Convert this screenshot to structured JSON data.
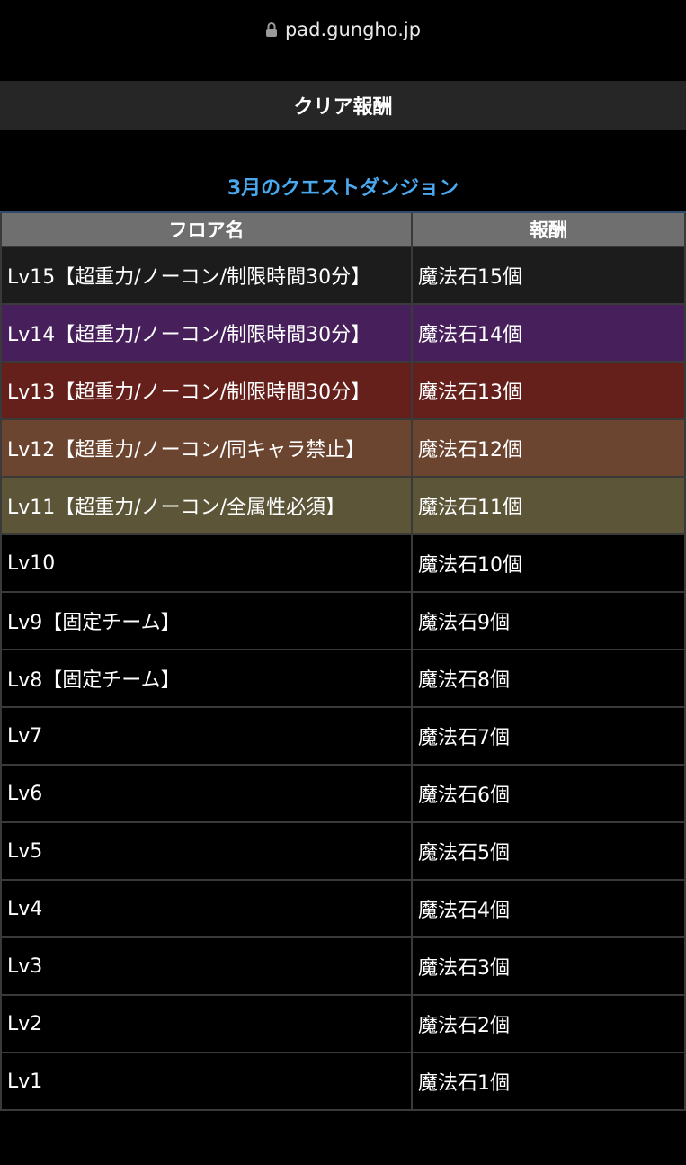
{
  "browser": {
    "url": "pad.gungho.jp",
    "lock_icon": "lock-icon"
  },
  "section": {
    "title": "クリア報酬"
  },
  "subtitle": "3月のクエストダンジョン",
  "table": {
    "headers": [
      "フロア名",
      "報酬"
    ],
    "rows": [
      {
        "floor": "Lv15【超重力/ノーコン/制限時間30分】",
        "reward": "魔法石15個",
        "color": "#1c1c1c"
      },
      {
        "floor": "Lv14【超重力/ノーコン/制限時間30分】",
        "reward": "魔法石14個",
        "color": "#461f5b"
      },
      {
        "floor": "Lv13【超重力/ノーコン/制限時間30分】",
        "reward": "魔法石13個",
        "color": "#66201b"
      },
      {
        "floor": "Lv12【超重力/ノーコン/同キャラ禁止】",
        "reward": "魔法石12個",
        "color": "#6c4530"
      },
      {
        "floor": "Lv11【超重力/ノーコン/全属性必須】",
        "reward": "魔法石11個",
        "color": "#5c5538"
      },
      {
        "floor": "Lv10",
        "reward": "魔法石10個",
        "color": "#000000"
      },
      {
        "floor": "Lv9【固定チーム】",
        "reward": "魔法石9個",
        "color": "#000000"
      },
      {
        "floor": "Lv8【固定チーム】",
        "reward": "魔法石8個",
        "color": "#000000"
      },
      {
        "floor": "Lv7",
        "reward": "魔法石7個",
        "color": "#000000"
      },
      {
        "floor": "Lv6",
        "reward": "魔法石6個",
        "color": "#000000"
      },
      {
        "floor": "Lv5",
        "reward": "魔法石5個",
        "color": "#000000"
      },
      {
        "floor": "Lv4",
        "reward": "魔法石4個",
        "color": "#000000"
      },
      {
        "floor": "Lv3",
        "reward": "魔法石3個",
        "color": "#000000"
      },
      {
        "floor": "Lv2",
        "reward": "魔法石2個",
        "color": "#000000"
      },
      {
        "floor": "Lv1",
        "reward": "魔法石1個",
        "color": "#000000"
      }
    ]
  },
  "colors": {
    "accent": "#4aa8ee",
    "header_bg": "#262626",
    "table_head_bg": "#6f6f6f"
  }
}
